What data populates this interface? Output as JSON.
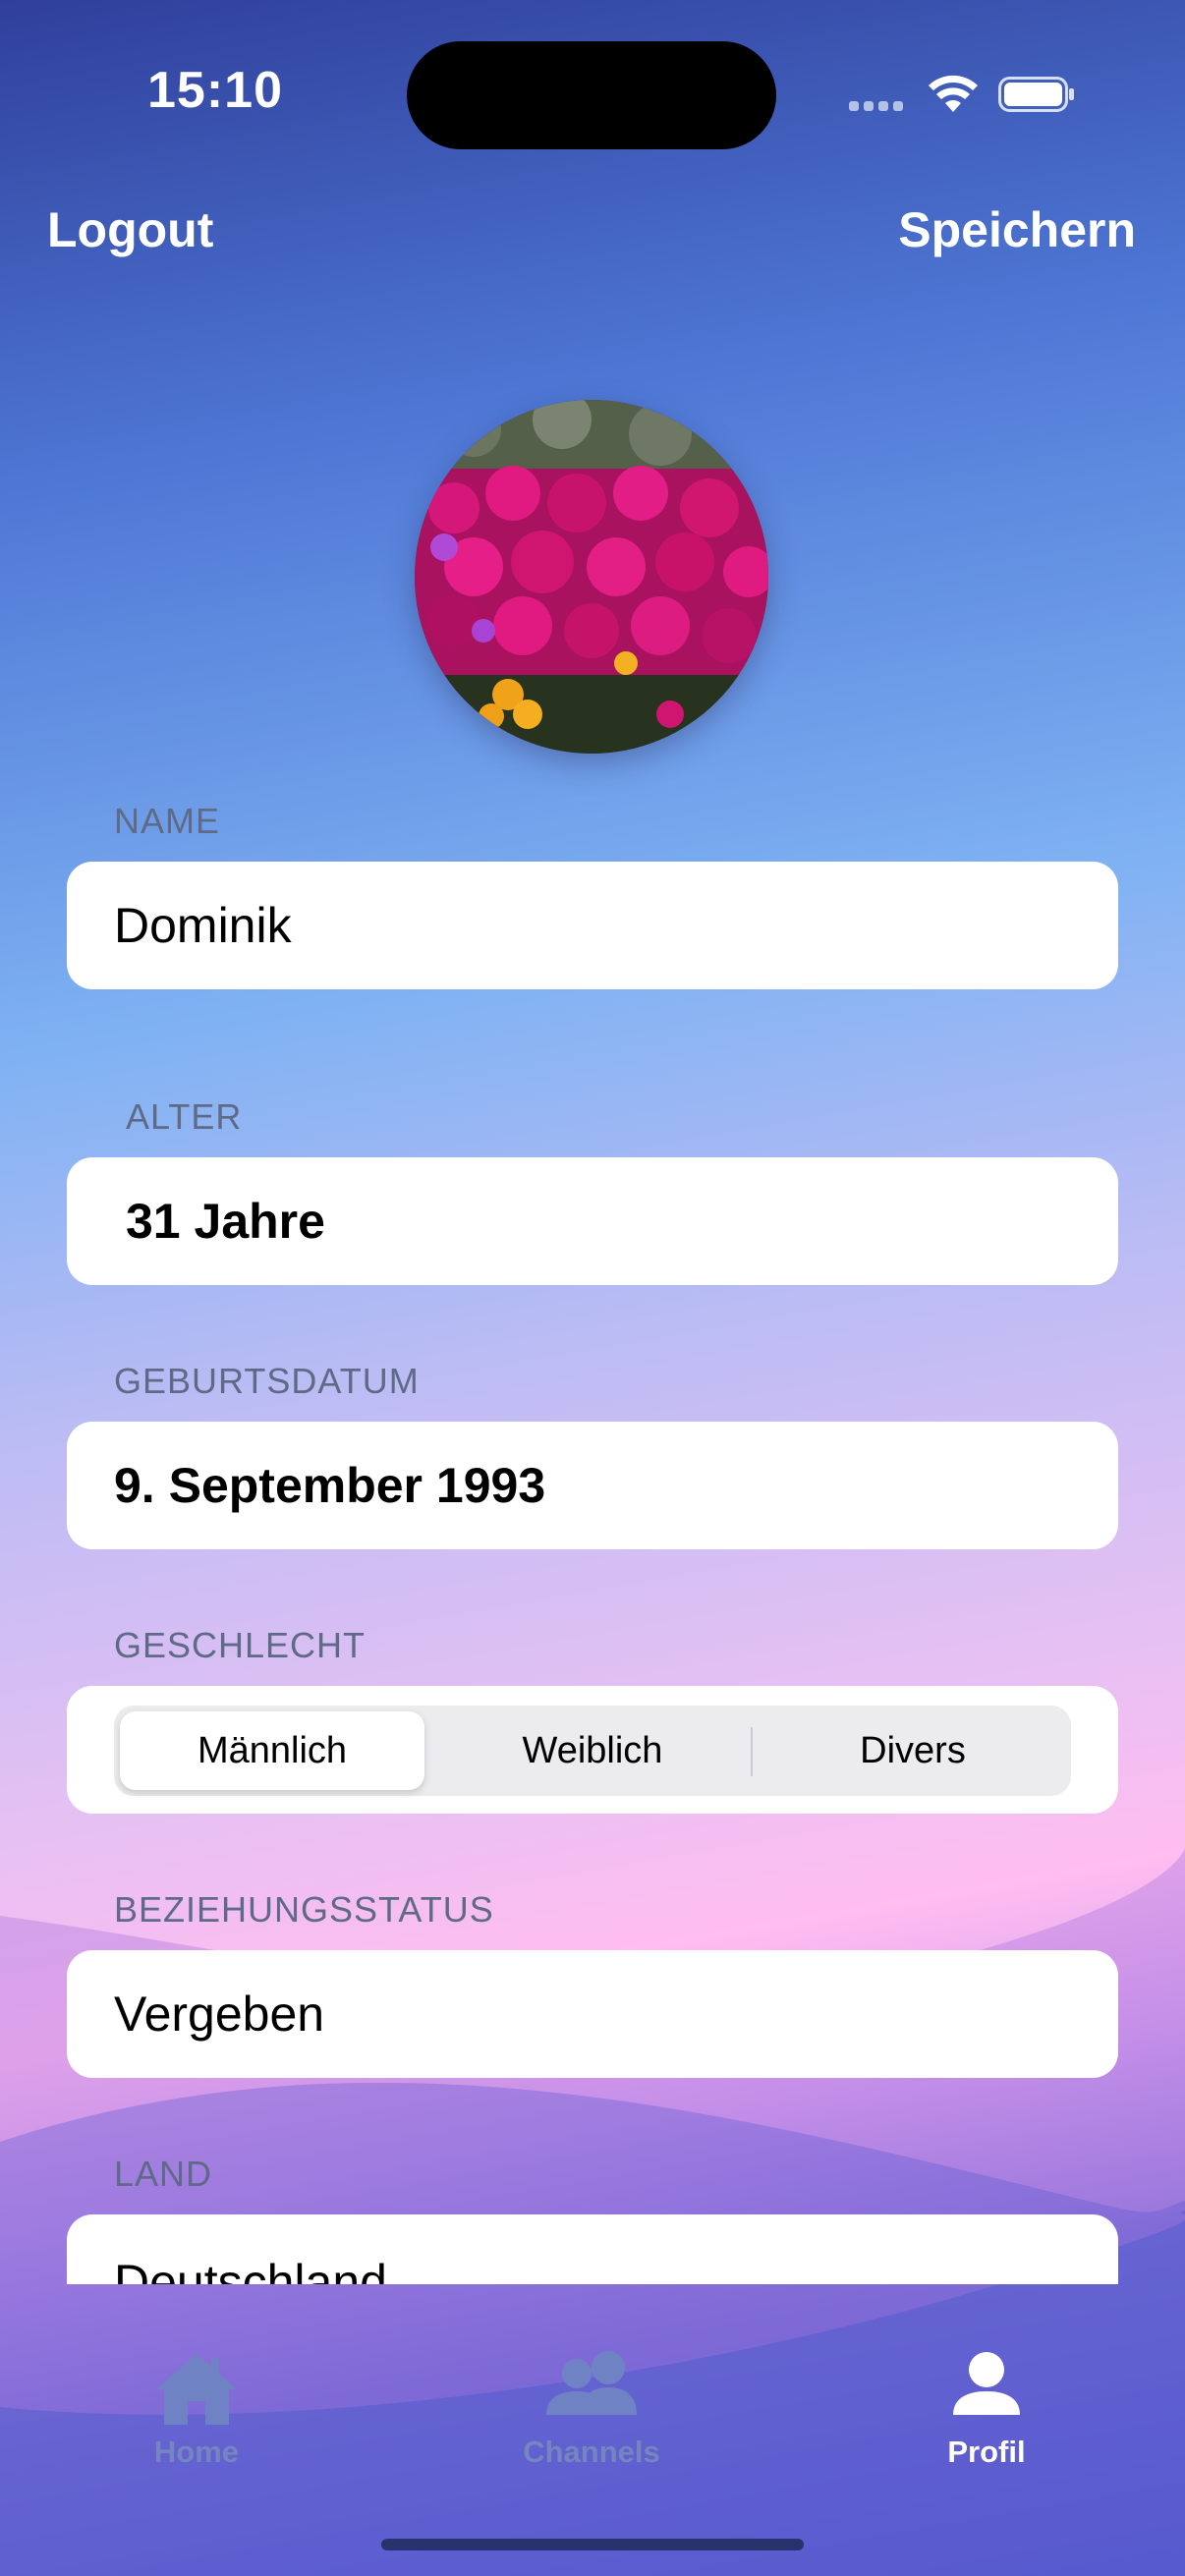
{
  "status_bar": {
    "time": "15:10"
  },
  "nav": {
    "left_label": "Logout",
    "right_label": "Speichern"
  },
  "profile": {
    "name": {
      "label": "NAME",
      "value": "Dominik"
    },
    "age": {
      "label": "ALTER",
      "value": "31 Jahre"
    },
    "birthdate": {
      "label": "GEBURTSDATUM",
      "value": "9. September 1993"
    },
    "gender": {
      "label": "GESCHLECHT",
      "options": [
        "Männlich",
        "Weiblich",
        "Divers"
      ],
      "selected": "Männlich"
    },
    "relationship": {
      "label": "BEZIEHUNGSSTATUS",
      "value": "Vergeben"
    },
    "country": {
      "label": "LAND",
      "value": "Deutschland"
    }
  },
  "tabs": [
    {
      "label": "Home",
      "icon": "house-icon",
      "active": false
    },
    {
      "label": "Channels",
      "icon": "people-icon",
      "active": false
    },
    {
      "label": "Profil",
      "icon": "person-icon",
      "active": true
    }
  ],
  "colors": {
    "accent": "#ffffff",
    "inactive_tab": "#6f83c4",
    "label_gray": "#5f6a86"
  }
}
